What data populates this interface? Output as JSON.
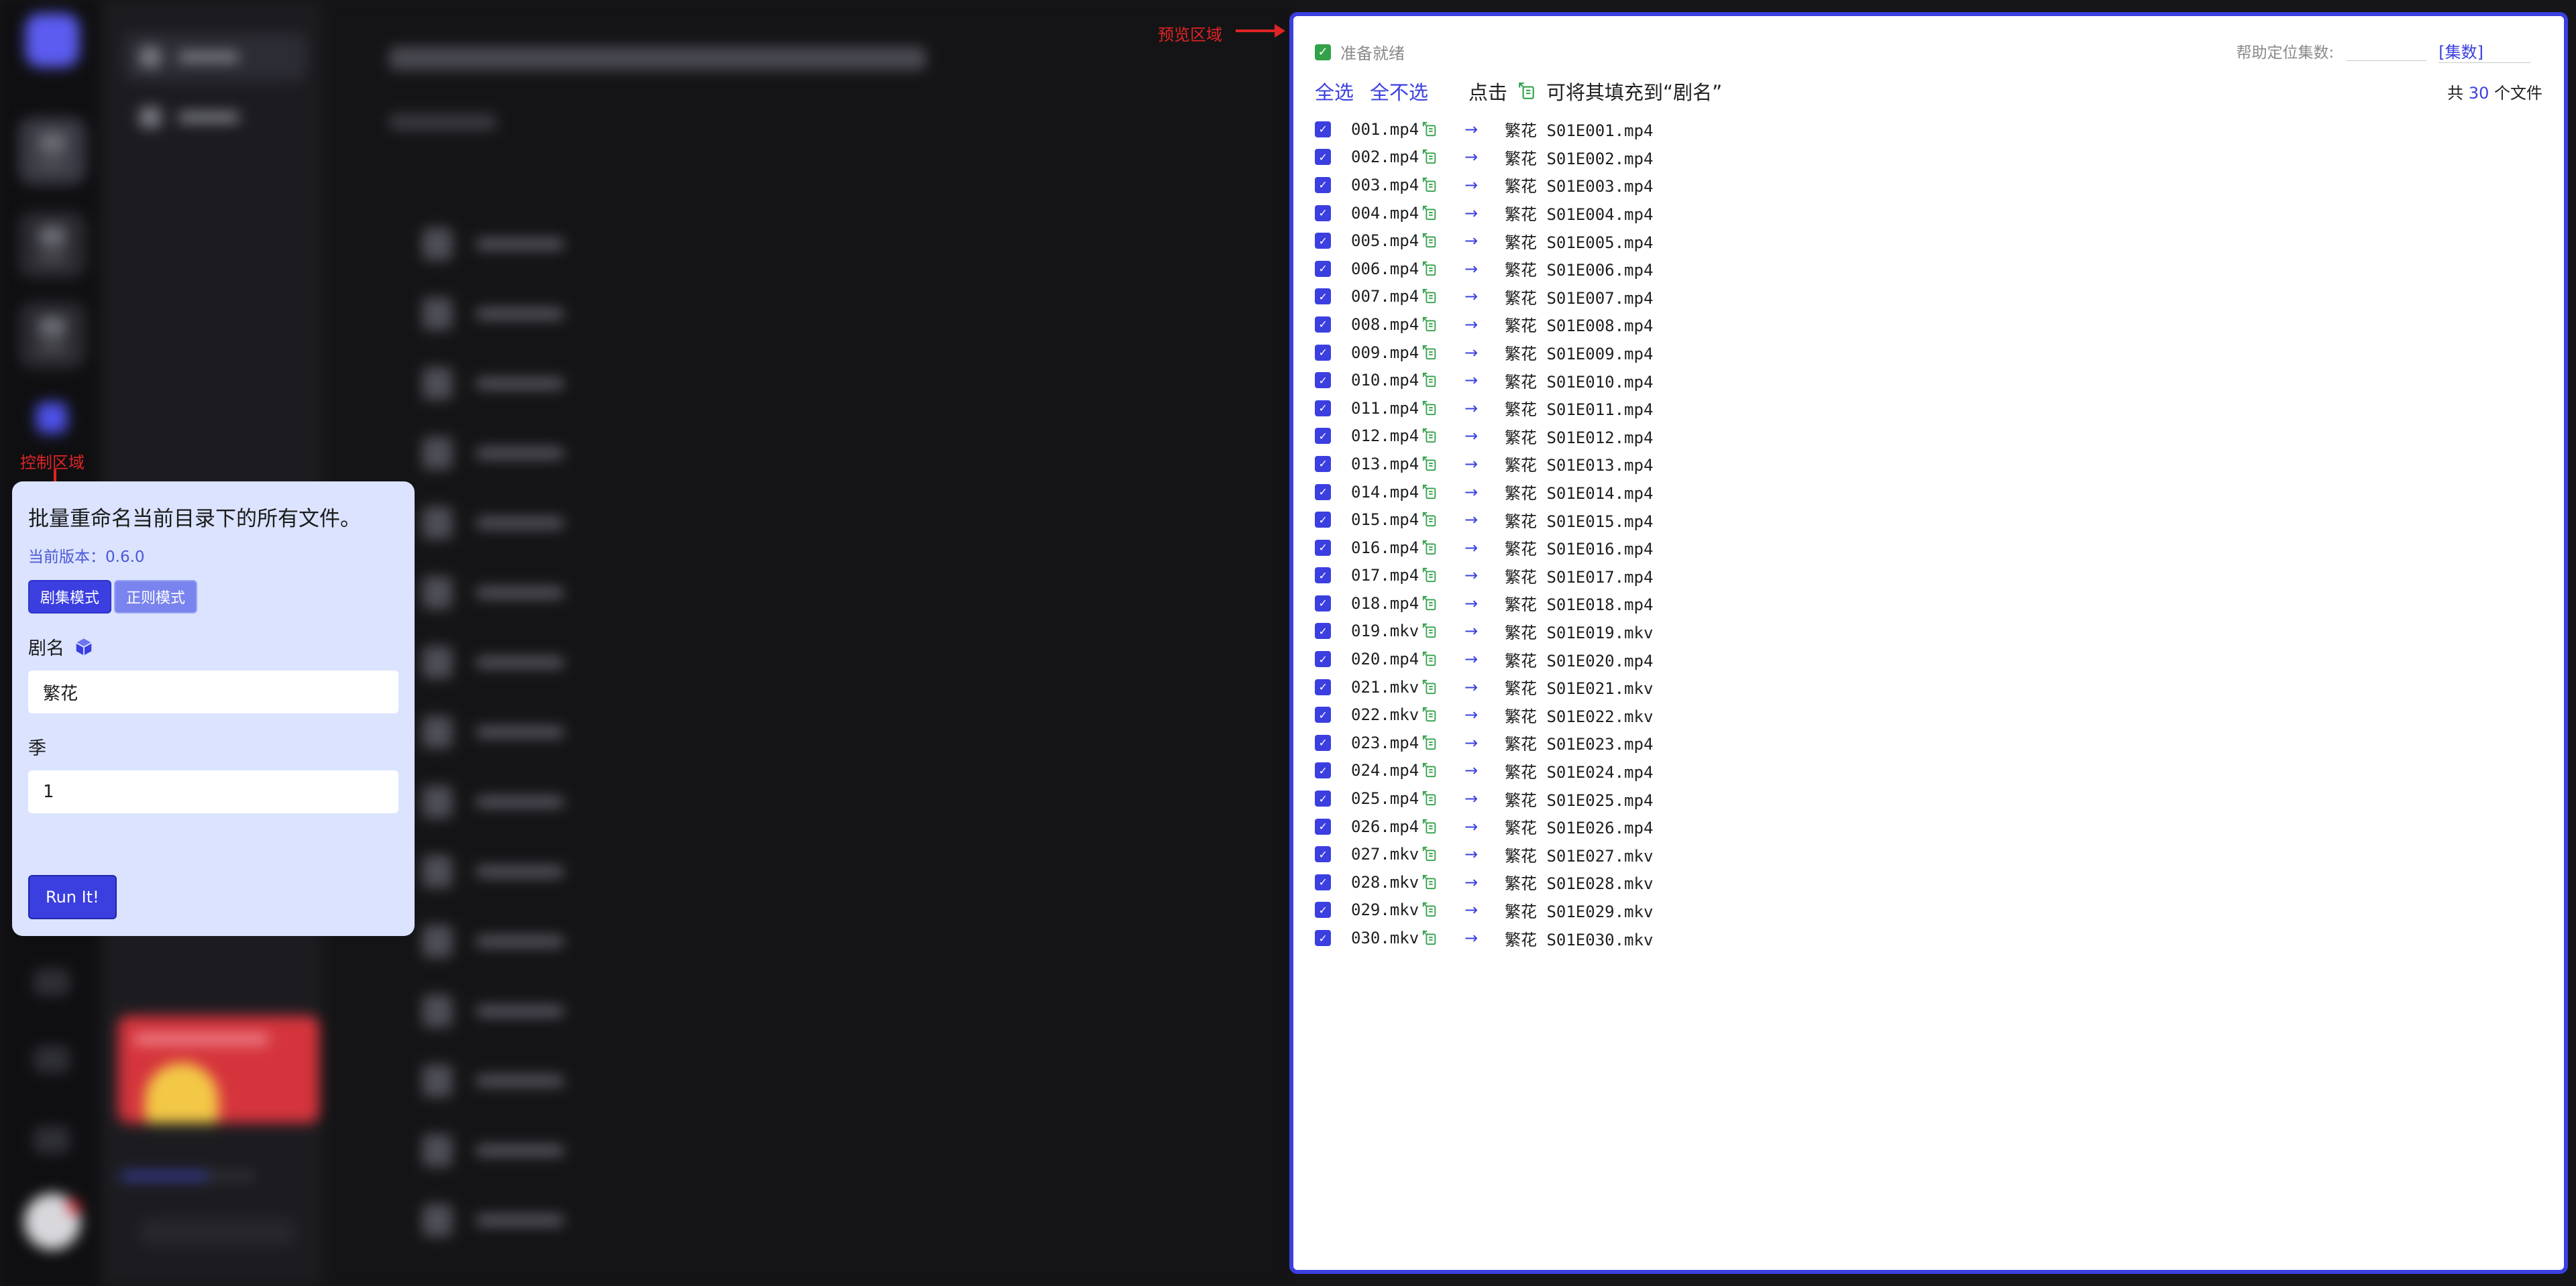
{
  "annotations": {
    "control_label": "控制区域",
    "preview_label": "预览区域"
  },
  "control": {
    "title": "批量重命名当前目录下的所有文件。",
    "version": "当前版本：0.6.0",
    "tabs": [
      {
        "label": "剧集模式",
        "active": true
      },
      {
        "label": "正则模式",
        "active": false
      }
    ],
    "show_name_label": "剧名",
    "show_name_value": "繁花",
    "season_label": "季",
    "season_value": "1",
    "run_label": "Run It!"
  },
  "preview": {
    "status": "准备就绪",
    "help_label": "帮助定位集数:",
    "help_tag": "[集数]",
    "select_all": "全选",
    "select_none": "全不选",
    "hint_prefix": "点击",
    "hint_suffix": "可将其填充到“剧名”",
    "count_prefix": "共",
    "count_value": "30",
    "count_suffix": "个文件",
    "arrow": "→",
    "files": [
      {
        "from": "001.mp4",
        "to": "繁花 S01E001.mp4"
      },
      {
        "from": "002.mp4",
        "to": "繁花 S01E002.mp4"
      },
      {
        "from": "003.mp4",
        "to": "繁花 S01E003.mp4"
      },
      {
        "from": "004.mp4",
        "to": "繁花 S01E004.mp4"
      },
      {
        "from": "005.mp4",
        "to": "繁花 S01E005.mp4"
      },
      {
        "from": "006.mp4",
        "to": "繁花 S01E006.mp4"
      },
      {
        "from": "007.mp4",
        "to": "繁花 S01E007.mp4"
      },
      {
        "from": "008.mp4",
        "to": "繁花 S01E008.mp4"
      },
      {
        "from": "009.mp4",
        "to": "繁花 S01E009.mp4"
      },
      {
        "from": "010.mp4",
        "to": "繁花 S01E010.mp4"
      },
      {
        "from": "011.mp4",
        "to": "繁花 S01E011.mp4"
      },
      {
        "from": "012.mp4",
        "to": "繁花 S01E012.mp4"
      },
      {
        "from": "013.mp4",
        "to": "繁花 S01E013.mp4"
      },
      {
        "from": "014.mp4",
        "to": "繁花 S01E014.mp4"
      },
      {
        "from": "015.mp4",
        "to": "繁花 S01E015.mp4"
      },
      {
        "from": "016.mp4",
        "to": "繁花 S01E016.mp4"
      },
      {
        "from": "017.mp4",
        "to": "繁花 S01E017.mp4"
      },
      {
        "from": "018.mp4",
        "to": "繁花 S01E018.mp4"
      },
      {
        "from": "019.mkv",
        "to": "繁花 S01E019.mkv"
      },
      {
        "from": "020.mp4",
        "to": "繁花 S01E020.mp4"
      },
      {
        "from": "021.mkv",
        "to": "繁花 S01E021.mkv"
      },
      {
        "from": "022.mkv",
        "to": "繁花 S01E022.mkv"
      },
      {
        "from": "023.mp4",
        "to": "繁花 S01E023.mp4"
      },
      {
        "from": "024.mp4",
        "to": "繁花 S01E024.mp4"
      },
      {
        "from": "025.mp4",
        "to": "繁花 S01E025.mp4"
      },
      {
        "from": "026.mp4",
        "to": "繁花 S01E026.mp4"
      },
      {
        "from": "027.mkv",
        "to": "繁花 S01E027.mkv"
      },
      {
        "from": "028.mkv",
        "to": "繁花 S01E028.mkv"
      },
      {
        "from": "029.mkv",
        "to": "繁花 S01E029.mkv"
      },
      {
        "from": "030.mkv",
        "to": "繁花 S01E030.mkv"
      }
    ]
  },
  "icons": {
    "fill_icon": "fill-into-name-icon",
    "cube_icon": "cube-icon",
    "check_icon": "checkbox-checked-icon"
  },
  "colors": {
    "accent": "#3b3fe0",
    "control_bg": "#dbe3ff",
    "annotation": "#e02424",
    "status_green": "#33a14a"
  }
}
